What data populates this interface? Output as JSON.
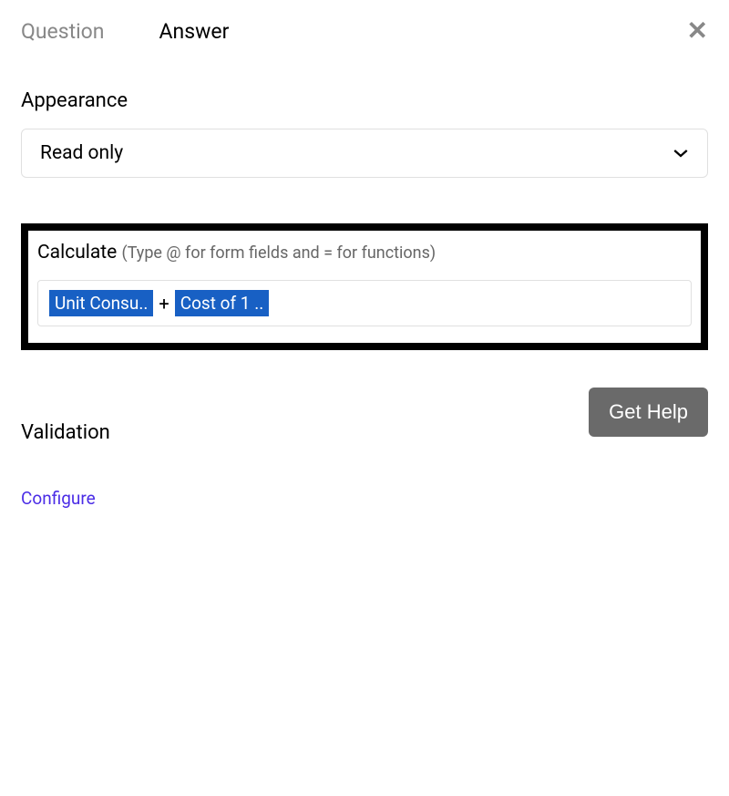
{
  "tabs": {
    "question": "Question",
    "answer": "Answer"
  },
  "appearance": {
    "label": "Appearance",
    "selected": "Read only"
  },
  "calculate": {
    "label": "Calculate",
    "hint": "(Type @ for form fields and = for functions)",
    "chip1": "Unit Consu..",
    "operator": "+",
    "chip2": "Cost of 1 .."
  },
  "help_button": "Get Help",
  "validation": {
    "label": "Validation",
    "configure": "Configure"
  }
}
